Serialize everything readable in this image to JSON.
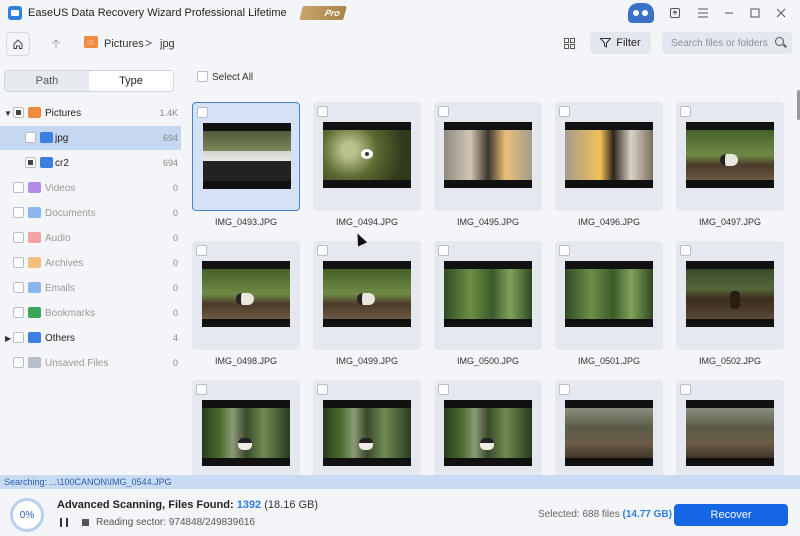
{
  "app": {
    "title": "EaseUS Data Recovery Wizard Professional Lifetime",
    "badge": "Pro"
  },
  "window_controls": [
    "minimize-icon",
    "maximize-icon",
    "close-icon"
  ],
  "toolbar": {
    "breadcrumb": [
      "Pictures",
      "jpg"
    ],
    "breadcrumb_separator": ">",
    "filter_label": "Filter",
    "search_placeholder": "Search files or folders"
  },
  "sidebar": {
    "tabs": [
      "Path",
      "Type"
    ],
    "active_tab": "Type",
    "tree": [
      {
        "label": "Pictures",
        "count": "1.4K",
        "icon_color": "#f08a3c",
        "level": 0,
        "expanded": true,
        "state": "partial"
      },
      {
        "label": "jpg",
        "count": "694",
        "icon_color": "#3b7fe3",
        "level": 1,
        "state": "unchecked",
        "selected": true
      },
      {
        "label": "cr2",
        "count": "694",
        "icon_color": "#3b7fe3",
        "level": 1,
        "state": "partial"
      },
      {
        "label": "Videos",
        "count": "0",
        "icon_color": "#b48be6",
        "level": 0,
        "dim": true
      },
      {
        "label": "Documents",
        "count": "0",
        "icon_color": "#8db6ee",
        "level": 0,
        "dim": true
      },
      {
        "label": "Audio",
        "count": "0",
        "icon_color": "#f2a3a3",
        "level": 0,
        "dim": true
      },
      {
        "label": "Archives",
        "count": "0",
        "icon_color": "#f2bf7a",
        "level": 0,
        "dim": true
      },
      {
        "label": "Emails",
        "count": "0",
        "icon_color": "#8db6ee",
        "level": 0,
        "dim": true
      },
      {
        "label": "Bookmarks",
        "count": "0",
        "icon_color": "#3aa55c",
        "level": 0,
        "dim": true
      },
      {
        "label": "Others",
        "count": "4",
        "icon_color": "#3b7fe3",
        "level": 0,
        "collapsed": true
      },
      {
        "label": "Unsaved Files",
        "count": "0",
        "icon_color": "#b7bec9",
        "level": 0,
        "dim": true
      }
    ]
  },
  "main": {
    "select_all_label": "Select All",
    "files": [
      {
        "name": "IMG_0493.JPG",
        "selected": true,
        "scene": "window"
      },
      {
        "name": "IMG_0494.JPG",
        "scene": "foliage"
      },
      {
        "name": "IMG_0495.JPG",
        "scene": "person"
      },
      {
        "name": "IMG_0496.JPG",
        "scene": "person2"
      },
      {
        "name": "IMG_0497.JPG",
        "scene": "panda"
      },
      {
        "name": "IMG_0498.JPG",
        "scene": "panda"
      },
      {
        "name": "IMG_0499.JPG",
        "scene": "panda"
      },
      {
        "name": "IMG_0500.JPG",
        "scene": "forest"
      },
      {
        "name": "IMG_0501.JPG",
        "scene": "forest"
      },
      {
        "name": "IMG_0502.JPG",
        "scene": "dark"
      },
      {
        "name": "",
        "scene": "trees"
      },
      {
        "name": "",
        "scene": "trees"
      },
      {
        "name": "",
        "scene": "trees"
      },
      {
        "name": "",
        "scene": "logs"
      },
      {
        "name": "",
        "scene": "logs"
      }
    ]
  },
  "status": {
    "searching": "Searching: ...\\100CANON\\IMG_0544.JPG",
    "progress": "0%",
    "scan_title": "Advanced Scanning, Files Found:",
    "files_found": "1392",
    "found_size": "(18.16 GB)",
    "reading_sector": "Reading sector: 974848/249839616",
    "selected_prefix": "Selected: 688 files",
    "selected_size": "(14.77 GB)",
    "recover_label": "Recover"
  }
}
